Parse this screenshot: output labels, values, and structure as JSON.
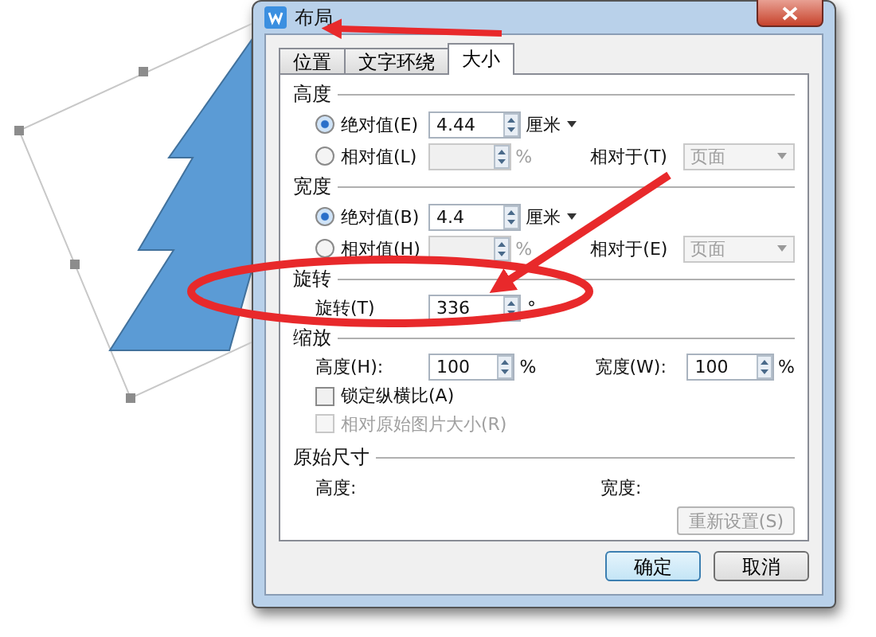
{
  "window": {
    "title": "布局"
  },
  "tabs": [
    {
      "label": "位置",
      "selected": false
    },
    {
      "label": "文字环绕",
      "selected": false
    },
    {
      "label": "大小",
      "selected": true
    }
  ],
  "size_groups": [
    {
      "title": "高度",
      "absolute": {
        "label": "绝对值(E)",
        "selected": true,
        "value": "4.44",
        "unit": "厘米"
      },
      "relative": {
        "label": "相对值(L)",
        "selected": false,
        "disabled": true,
        "unit": "%",
        "relative_to_label": "相对于(T)",
        "relative_to_value": "页面"
      }
    },
    {
      "title": "宽度",
      "absolute": {
        "label": "绝对值(B)",
        "selected": true,
        "value": "4.4",
        "unit": "厘米"
      },
      "relative": {
        "label": "相对值(H)",
        "selected": false,
        "disabled": true,
        "unit": "%",
        "relative_to_label": "相对于(E)",
        "relative_to_value": "页面"
      }
    }
  ],
  "rotation": {
    "title": "旋转",
    "label": "旋转(T)",
    "value": "336",
    "unit": "°"
  },
  "scale": {
    "title": "缩放",
    "height_label": "高度(H):",
    "height_value": "100",
    "height_unit": "%",
    "width_label": "宽度(W):",
    "width_value": "100",
    "width_unit": "%",
    "checkboxes": [
      {
        "label": "锁定纵横比(A)",
        "checked": false,
        "disabled": false
      },
      {
        "label": "相对原始图片大小(R)",
        "checked": false,
        "disabled": true
      }
    ]
  },
  "original_size": {
    "title": "原始尺寸",
    "height_label": "高度:",
    "width_label": "宽度:",
    "reset_button": {
      "label": "重新设置(S)",
      "disabled": true
    }
  },
  "buttons": [
    {
      "label": "确定",
      "default": true
    },
    {
      "label": "取消",
      "default": false
    }
  ]
}
